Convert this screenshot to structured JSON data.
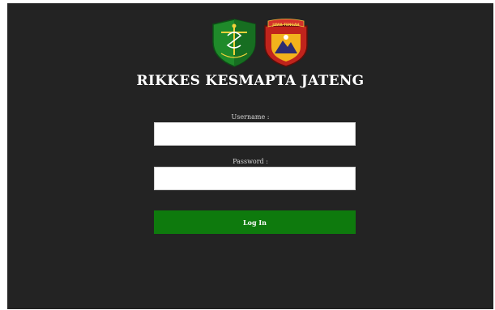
{
  "app": {
    "title": "RIKKES KESMAPTA JATENG",
    "logos": [
      {
        "icon": "medical-shield-emblem-icon"
      },
      {
        "icon": "police-jawa-tengah-emblem-icon",
        "banner_text": "JAWA TENGAH"
      }
    ]
  },
  "form": {
    "username_label": "Username :",
    "username_value": "",
    "password_label": "Password :",
    "password_value": "",
    "submit_label": "Log In"
  },
  "colors": {
    "background": "#232323",
    "button": "#0e7a0d",
    "text": "#ffffff"
  }
}
